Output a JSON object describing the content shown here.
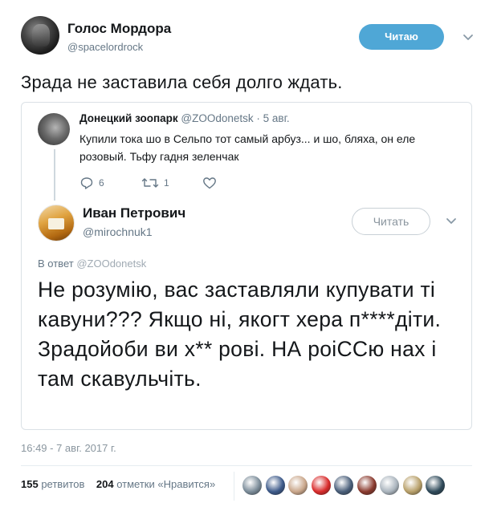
{
  "author": {
    "name": "Голос Мордора",
    "handle": "@spacelordrock",
    "follow_label": "Читаю"
  },
  "tweet": {
    "text": "Зрада не заставила себя долго ждать."
  },
  "quoted": {
    "name": "Донецкий зоопарк",
    "handle_date": "@ZOOdonetsk · 5 авг.",
    "text": "Купили тока шо в Сельпо тот самый арбуз... и шо, бляха, он еле розовый. Тьфу гадня зеленчак",
    "reply_count": "6",
    "retweet_count": "1"
  },
  "reply": {
    "name": "Иван Петрович",
    "handle": "@mirochnuk1",
    "follow_label": "Читать",
    "in_reply_prefix": "В ответ",
    "in_reply_handle": "@ZOOdonetsk",
    "text": "Не розумію, вас заставляли купувати ті кавуни??? Якщо ні, якогт хера п****діти. Зрадойоби ви х** рові. НА роіССю нах і там скавульчіть."
  },
  "timestamp": "16:49 - 7 авг. 2017 г.",
  "stats": {
    "retweets_count": "155",
    "retweets_label": "ретвитов",
    "likes_count": "204",
    "likes_label": "отметки «Нравится»"
  },
  "likers": [
    {
      "name": "liker-1",
      "color": "#7b8c99"
    },
    {
      "name": "liker-2",
      "color": "#3d5a8a"
    },
    {
      "name": "liker-3",
      "color": "#c9a68a"
    },
    {
      "name": "liker-4",
      "color": "#d92b2b"
    },
    {
      "name": "liker-5",
      "color": "#4a5f7a"
    },
    {
      "name": "liker-6",
      "color": "#8a3a2e"
    },
    {
      "name": "liker-7",
      "color": "#aab4bd"
    },
    {
      "name": "liker-8",
      "color": "#b8a06a"
    },
    {
      "name": "liker-9",
      "color": "#2f4a5a"
    }
  ],
  "colors": {
    "accent": "#4fa7d6",
    "muted": "#657786",
    "border": "#dbe1e6"
  }
}
